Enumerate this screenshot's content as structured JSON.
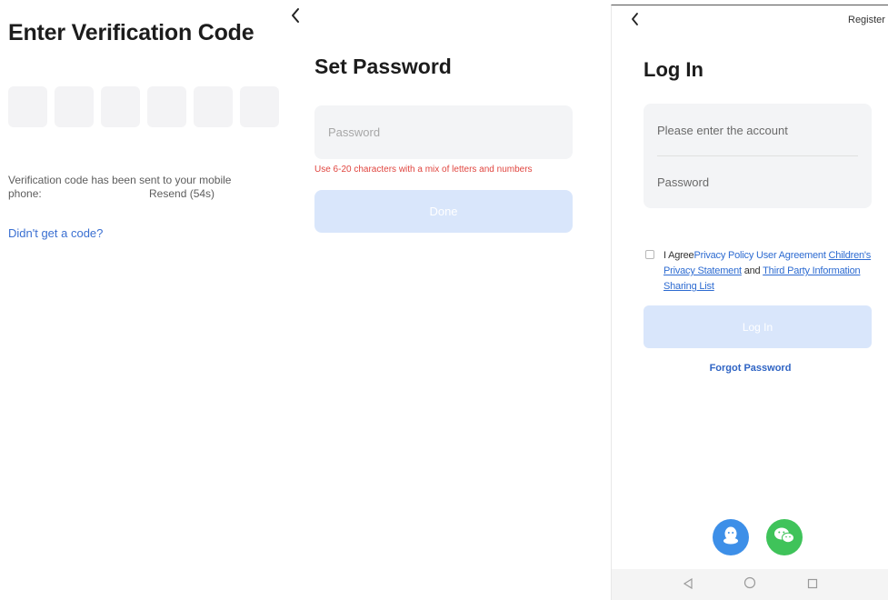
{
  "verify": {
    "title": "Enter Verification Code",
    "code_boxes": [
      "",
      "",
      "",
      "",
      "",
      ""
    ],
    "sent_line1": "Verification code has been sent to your mobile",
    "sent_line2": "phone:",
    "resend": "Resend (54s)",
    "no_code": "Didn't get a code?"
  },
  "set_password": {
    "back_icon": "chevron-left-icon",
    "title": "Set Password",
    "password_placeholder": "Password",
    "hint": "Use 6-20 characters with a mix of letters and numbers",
    "done_label": "Done"
  },
  "login": {
    "back_icon": "chevron-left-icon",
    "register": "Register",
    "title": "Log In",
    "account_placeholder": "Please enter the account",
    "password_placeholder": "Password",
    "agree_prefix": "I Agree",
    "privacy_policy": "Privacy Policy",
    "user_agreement": "User Agreement",
    "childrens_privacy": "Children's Privacy Statement",
    "and": "and",
    "third_party": "Third Party Information Sharing List",
    "login_label": "Log In",
    "forgot": "Forgot Password",
    "social": [
      "qq-icon",
      "wechat-icon"
    ],
    "nav_icons": [
      "back-triangle-icon",
      "home-circle-icon",
      "recents-square-icon"
    ]
  },
  "colors": {
    "link_blue": "#2d6bd1",
    "disabled_button": "#d9e6fb",
    "error_red": "#e0453f",
    "qq_blue": "#3d8fe8",
    "wechat_green": "#3fc35a"
  }
}
